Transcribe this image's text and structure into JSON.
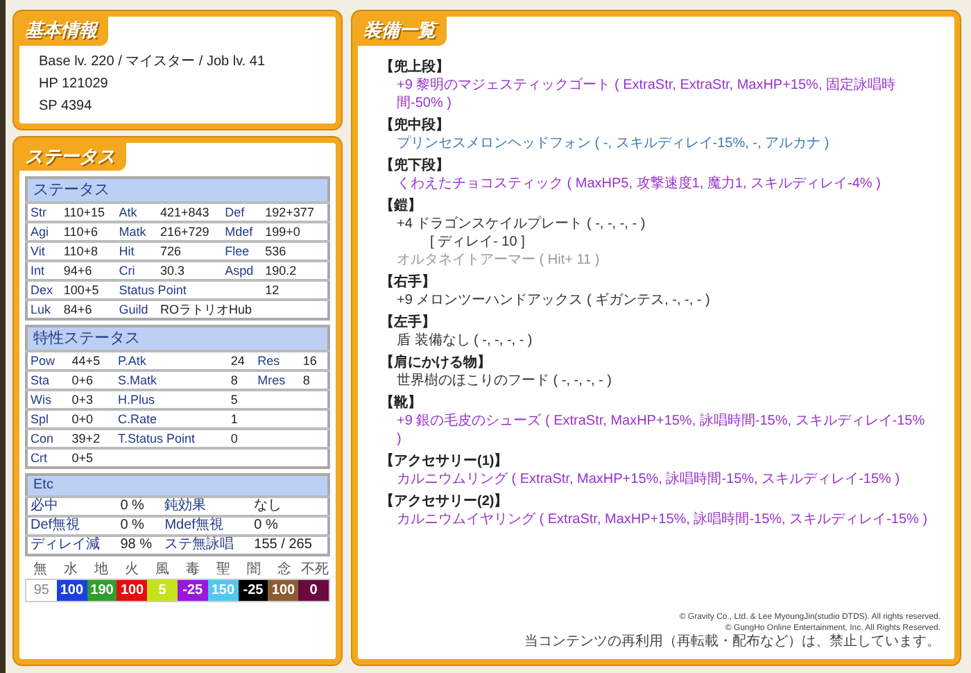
{
  "basic_info": {
    "title": "基本情報",
    "lines": [
      "Base lv. 220 / マイスター / Job lv. 41",
      "HP 121029",
      "SP 4394"
    ]
  },
  "status": {
    "title": "ステータス",
    "sections": [
      {
        "title": "ステータス",
        "kind": "main",
        "rows": [
          [
            "Str",
            "110+15",
            "Atk",
            "421+843",
            "Def",
            "192+377"
          ],
          [
            "Agi",
            "110+6",
            "Matk",
            "216+729",
            "Mdef",
            "199+0"
          ],
          [
            "Vit",
            "110+8",
            "Hit",
            "726",
            "Flee",
            "536"
          ],
          [
            "Int",
            "94+6",
            "Cri",
            "30.3",
            "Aspd",
            "190.2"
          ],
          [
            "Dex",
            "100+5",
            {
              "text": "Status Point",
              "colspan": 3
            },
            "12"
          ],
          [
            "Luk",
            "84+6",
            "Guild",
            {
              "text": "ROラトリオHub",
              "colspan": 3
            }
          ]
        ]
      },
      {
        "title": "特性ステータス",
        "kind": "trait",
        "rows": [
          [
            "Pow",
            "44+5",
            "P.Atk",
            "24",
            "Res",
            "16"
          ],
          [
            "Sta",
            "0+6",
            "S.Matk",
            "8",
            "Mres",
            "8"
          ],
          [
            "Wis",
            "0+3",
            "H.Plus",
            {
              "text": "5",
              "colspan": 3
            }
          ],
          [
            "Spl",
            "0+0",
            "C.Rate",
            {
              "text": "1",
              "colspan": 3
            }
          ],
          [
            "Con",
            "39+2",
            "T.Status Point",
            {
              "text": "0",
              "colspan": 3
            }
          ],
          [
            "Crt",
            {
              "text": "0+5",
              "colspan": 5
            }
          ]
        ]
      },
      {
        "title": "Etc",
        "kind": "etc",
        "rows": [
          [
            "必中",
            "0 %",
            "鈍効果",
            "なし"
          ],
          [
            "Def無視",
            "0 %",
            "Mdef無視",
            "0 %"
          ],
          [
            "ディレイ減",
            "98 %",
            "ステ無詠唱",
            "155 / 265"
          ]
        ]
      }
    ],
    "elements": [
      {
        "label": "無",
        "value": "95",
        "color": "#ffffff"
      },
      {
        "label": "水",
        "value": "100",
        "color": "#1c3fe0"
      },
      {
        "label": "地",
        "value": "190",
        "color": "#2ea02e"
      },
      {
        "label": "火",
        "value": "100",
        "color": "#e80c0c"
      },
      {
        "label": "風",
        "value": "5",
        "color": "#c6e21e"
      },
      {
        "label": "毒",
        "value": "-25",
        "color": "#9a18d8"
      },
      {
        "label": "聖",
        "value": "150",
        "color": "#50c8f2"
      },
      {
        "label": "闇",
        "value": "-25",
        "color": "#000000"
      },
      {
        "label": "念",
        "value": "100",
        "color": "#8a5e30"
      },
      {
        "label": "不死",
        "value": "0",
        "color": "#6a0a40"
      }
    ]
  },
  "equipment": {
    "title": "装備一覧",
    "slots": [
      {
        "slot": "【兜上段】",
        "lines": [
          {
            "kind": "item",
            "text": "+9 黎明のマジェスティックゴート ( ExtraStr, ExtraStr, MaxHP+15%, 固定詠唱時間-50% )",
            "color": "#9933cc"
          }
        ]
      },
      {
        "slot": "【兜中段】",
        "lines": [
          {
            "kind": "item",
            "text": "プリンセスメロンヘッドフォン ( -, スキルディレイ-15%, -, アルカナ )",
            "color": "#3a7ab8"
          }
        ]
      },
      {
        "slot": "【兜下段】",
        "lines": [
          {
            "kind": "item",
            "text": "くわえたチョコスティック ( MaxHP5, 攻撃速度1, 魔力1, スキルディレイ-4% )",
            "color": "#9933cc"
          }
        ]
      },
      {
        "slot": "【鎧】",
        "lines": [
          {
            "kind": "item",
            "text": "+4 ドラゴンスケイルプレート ( -, -, -, - )",
            "color": "#333333"
          },
          {
            "kind": "note",
            "text": "[ ディレイ- 10 ]",
            "color": "#333333"
          },
          {
            "kind": "item",
            "text": "オルタネイトアーマー ( Hit+ 11 )",
            "color": "#999999"
          }
        ]
      },
      {
        "slot": "【右手】",
        "lines": [
          {
            "kind": "item",
            "text": "+9 メロンツーハンドアックス ( ギガンテス, -, -, - )",
            "color": "#333333"
          }
        ]
      },
      {
        "slot": "【左手】",
        "lines": [
          {
            "kind": "item",
            "text": "盾 装備なし ( -, -, -, - )",
            "color": "#333333"
          }
        ]
      },
      {
        "slot": "【肩にかける物】",
        "lines": [
          {
            "kind": "item",
            "text": "世界樹のほこりのフード ( -, -, -, - )",
            "color": "#333333"
          }
        ]
      },
      {
        "slot": "【靴】",
        "lines": [
          {
            "kind": "item",
            "text": "+9 銀の毛皮のシューズ ( ExtraStr, MaxHP+15%, 詠唱時間-15%, スキルディレイ-15% )",
            "color": "#9933cc"
          }
        ]
      },
      {
        "slot": "【アクセサリー(1)】",
        "lines": [
          {
            "kind": "item",
            "text": "カルニウムリング ( ExtraStr, MaxHP+15%, 詠唱時間-15%, スキルディレイ-15% )",
            "color": "#9933cc"
          }
        ]
      },
      {
        "slot": "【アクセサリー(2)】",
        "lines": [
          {
            "kind": "item",
            "text": "カルニウムイヤリング ( ExtraStr, MaxHP+15%, 詠唱時間-15%, スキルディレイ-15% )",
            "color": "#9933cc"
          }
        ]
      }
    ],
    "copyright": [
      "© Gravity Co., Ltd. & Lee MyoungJin(studio DTDS). All rights reserved.",
      "© GungHo Online Entertainment, Inc. All Rights Reserved.",
      "当コンテンツの再利用（再転載・配布など）は、禁止しています。"
    ]
  }
}
